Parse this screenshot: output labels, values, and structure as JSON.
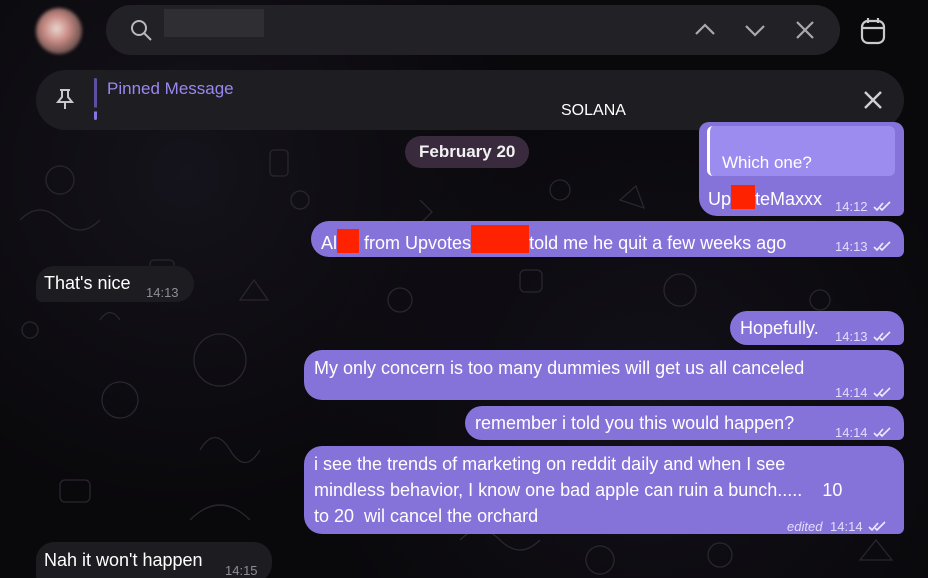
{
  "header": {
    "search_placeholder": "",
    "search_value": ""
  },
  "pinned": {
    "title": "Pinned Message",
    "text": "SOLANA"
  },
  "date_chip": "February 20",
  "messages": [
    {
      "id": "m1",
      "dir": "out",
      "reply_quote": "Which one?",
      "text_pre": "Up",
      "text_post": "teMaxxx",
      "time": "14:12",
      "edited": ""
    },
    {
      "id": "m2",
      "dir": "out",
      "text_pre": "Al",
      "text_mid": " from Upvotes",
      "text_post": "told me he quit a few weeks ago",
      "time": "14:13",
      "edited": ""
    },
    {
      "id": "m3",
      "dir": "in",
      "text": "That's nice",
      "time": "14:13",
      "edited": ""
    },
    {
      "id": "m4",
      "dir": "out",
      "text": "Hopefully.",
      "time": "14:13",
      "edited": ""
    },
    {
      "id": "m5",
      "dir": "out",
      "text": "My only concern is too many dummies will get us all canceled",
      "time": "14:14",
      "edited": ""
    },
    {
      "id": "m6",
      "dir": "out",
      "text": "remember i told you this would happen?",
      "time": "14:14",
      "edited": ""
    },
    {
      "id": "m7",
      "dir": "out",
      "lines": [
        "i see the trends of marketing on reddit daily and when I see",
        "mindless behavior, I know one bad apple can ruin a bunch.....    10",
        "to 20  wil cancel the orchard"
      ],
      "time": "14:14",
      "edited": "edited"
    },
    {
      "id": "m8",
      "dir": "in",
      "text": "Nah it won't happen",
      "time": "14:15",
      "edited": ""
    }
  ],
  "colors": {
    "outgoing_bubble": "#8673d9",
    "incoming_bubble": "#1d1c21",
    "accent": "#9b87f0",
    "redaction": "#ff2200"
  },
  "icons": [
    "search-icon",
    "chevron-up-icon",
    "chevron-down-icon",
    "close-icon",
    "calendar-icon",
    "pin-icon",
    "double-check-icon"
  ]
}
